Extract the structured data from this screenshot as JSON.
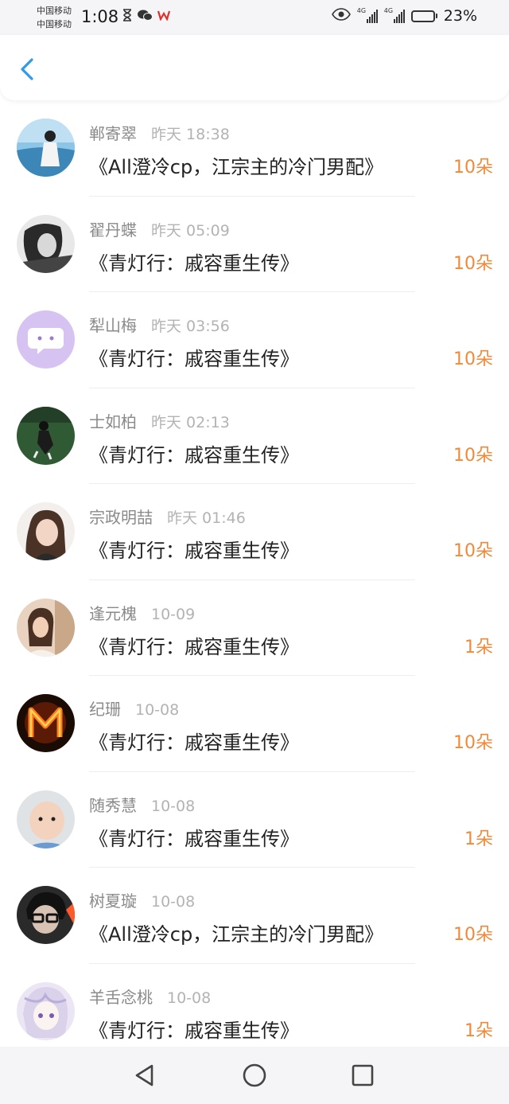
{
  "status_bar": {
    "carrier_1": "中国移动",
    "carrier_2": "中国移动",
    "time": "1:08",
    "network_1": "4G",
    "network_2": "4G",
    "battery_percent": "23%",
    "battery_level": 0.23,
    "icons": [
      "hourglass-icon",
      "wechat-icon",
      "wps-icon",
      "eye-icon",
      "signal-icon",
      "battery-icon"
    ]
  },
  "header": {
    "back_icon": "chevron-left-icon",
    "accent_color": "#2f9bea"
  },
  "colors": {
    "amount": "#f08a3a",
    "username": "#8a8a8a",
    "time": "#b3b3b3"
  },
  "records": [
    {
      "name": "郸寄翠",
      "time": "昨天 18:38",
      "book": "《All澄冷cp，江宗主的冷门男配》",
      "amount": "10朵"
    },
    {
      "name": "翟丹蝶",
      "time": "昨天 05:09",
      "book": "《青灯行：戚容重生传》",
      "amount": "10朵"
    },
    {
      "name": "犁山梅",
      "time": "昨天 03:56",
      "book": "《青灯行：戚容重生传》",
      "amount": "10朵"
    },
    {
      "name": "士如柏",
      "time": "昨天 02:13",
      "book": "《青灯行：戚容重生传》",
      "amount": "10朵"
    },
    {
      "name": "宗政明喆",
      "time": "昨天 01:46",
      "book": "《青灯行：戚容重生传》",
      "amount": "10朵"
    },
    {
      "name": "逢元槐",
      "time": "10-09",
      "book": "《青灯行：戚容重生传》",
      "amount": "1朵"
    },
    {
      "name": "纪珊",
      "time": "10-08",
      "book": "《青灯行：戚容重生传》",
      "amount": "10朵"
    },
    {
      "name": "随秀慧",
      "time": "10-08",
      "book": "《青灯行：戚容重生传》",
      "amount": "1朵"
    },
    {
      "name": "树夏璇",
      "time": "10-08",
      "book": "《All澄冷cp，江宗主的冷门男配》",
      "amount": "10朵"
    },
    {
      "name": "羊舌念桃",
      "time": "10-08",
      "book": "《青灯行：戚容重生传》",
      "amount": "1朵"
    }
  ],
  "system_nav": {
    "back_icon": "triangle-back-icon",
    "home_icon": "circle-home-icon",
    "recents_icon": "square-recents-icon"
  }
}
